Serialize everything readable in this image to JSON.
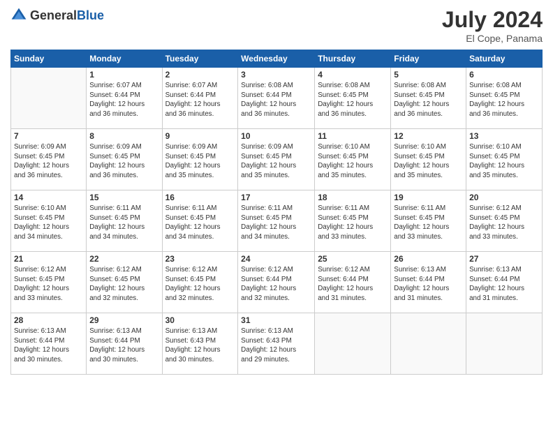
{
  "header": {
    "logo_general": "General",
    "logo_blue": "Blue",
    "main_title": "July 2024",
    "subtitle": "El Cope, Panama"
  },
  "weekdays": [
    "Sunday",
    "Monday",
    "Tuesday",
    "Wednesday",
    "Thursday",
    "Friday",
    "Saturday"
  ],
  "weeks": [
    [
      {
        "day": "",
        "info": ""
      },
      {
        "day": "1",
        "info": "Sunrise: 6:07 AM\nSunset: 6:44 PM\nDaylight: 12 hours\nand 36 minutes."
      },
      {
        "day": "2",
        "info": "Sunrise: 6:07 AM\nSunset: 6:44 PM\nDaylight: 12 hours\nand 36 minutes."
      },
      {
        "day": "3",
        "info": "Sunrise: 6:08 AM\nSunset: 6:44 PM\nDaylight: 12 hours\nand 36 minutes."
      },
      {
        "day": "4",
        "info": "Sunrise: 6:08 AM\nSunset: 6:45 PM\nDaylight: 12 hours\nand 36 minutes."
      },
      {
        "day": "5",
        "info": "Sunrise: 6:08 AM\nSunset: 6:45 PM\nDaylight: 12 hours\nand 36 minutes."
      },
      {
        "day": "6",
        "info": "Sunrise: 6:08 AM\nSunset: 6:45 PM\nDaylight: 12 hours\nand 36 minutes."
      }
    ],
    [
      {
        "day": "7",
        "info": "Sunrise: 6:09 AM\nSunset: 6:45 PM\nDaylight: 12 hours\nand 36 minutes."
      },
      {
        "day": "8",
        "info": "Sunrise: 6:09 AM\nSunset: 6:45 PM\nDaylight: 12 hours\nand 36 minutes."
      },
      {
        "day": "9",
        "info": "Sunrise: 6:09 AM\nSunset: 6:45 PM\nDaylight: 12 hours\nand 35 minutes."
      },
      {
        "day": "10",
        "info": "Sunrise: 6:09 AM\nSunset: 6:45 PM\nDaylight: 12 hours\nand 35 minutes."
      },
      {
        "day": "11",
        "info": "Sunrise: 6:10 AM\nSunset: 6:45 PM\nDaylight: 12 hours\nand 35 minutes."
      },
      {
        "day": "12",
        "info": "Sunrise: 6:10 AM\nSunset: 6:45 PM\nDaylight: 12 hours\nand 35 minutes."
      },
      {
        "day": "13",
        "info": "Sunrise: 6:10 AM\nSunset: 6:45 PM\nDaylight: 12 hours\nand 35 minutes."
      }
    ],
    [
      {
        "day": "14",
        "info": "Sunrise: 6:10 AM\nSunset: 6:45 PM\nDaylight: 12 hours\nand 34 minutes."
      },
      {
        "day": "15",
        "info": "Sunrise: 6:11 AM\nSunset: 6:45 PM\nDaylight: 12 hours\nand 34 minutes."
      },
      {
        "day": "16",
        "info": "Sunrise: 6:11 AM\nSunset: 6:45 PM\nDaylight: 12 hours\nand 34 minutes."
      },
      {
        "day": "17",
        "info": "Sunrise: 6:11 AM\nSunset: 6:45 PM\nDaylight: 12 hours\nand 34 minutes."
      },
      {
        "day": "18",
        "info": "Sunrise: 6:11 AM\nSunset: 6:45 PM\nDaylight: 12 hours\nand 33 minutes."
      },
      {
        "day": "19",
        "info": "Sunrise: 6:11 AM\nSunset: 6:45 PM\nDaylight: 12 hours\nand 33 minutes."
      },
      {
        "day": "20",
        "info": "Sunrise: 6:12 AM\nSunset: 6:45 PM\nDaylight: 12 hours\nand 33 minutes."
      }
    ],
    [
      {
        "day": "21",
        "info": "Sunrise: 6:12 AM\nSunset: 6:45 PM\nDaylight: 12 hours\nand 33 minutes."
      },
      {
        "day": "22",
        "info": "Sunrise: 6:12 AM\nSunset: 6:45 PM\nDaylight: 12 hours\nand 32 minutes."
      },
      {
        "day": "23",
        "info": "Sunrise: 6:12 AM\nSunset: 6:45 PM\nDaylight: 12 hours\nand 32 minutes."
      },
      {
        "day": "24",
        "info": "Sunrise: 6:12 AM\nSunset: 6:44 PM\nDaylight: 12 hours\nand 32 minutes."
      },
      {
        "day": "25",
        "info": "Sunrise: 6:12 AM\nSunset: 6:44 PM\nDaylight: 12 hours\nand 31 minutes."
      },
      {
        "day": "26",
        "info": "Sunrise: 6:13 AM\nSunset: 6:44 PM\nDaylight: 12 hours\nand 31 minutes."
      },
      {
        "day": "27",
        "info": "Sunrise: 6:13 AM\nSunset: 6:44 PM\nDaylight: 12 hours\nand 31 minutes."
      }
    ],
    [
      {
        "day": "28",
        "info": "Sunrise: 6:13 AM\nSunset: 6:44 PM\nDaylight: 12 hours\nand 30 minutes."
      },
      {
        "day": "29",
        "info": "Sunrise: 6:13 AM\nSunset: 6:44 PM\nDaylight: 12 hours\nand 30 minutes."
      },
      {
        "day": "30",
        "info": "Sunrise: 6:13 AM\nSunset: 6:43 PM\nDaylight: 12 hours\nand 30 minutes."
      },
      {
        "day": "31",
        "info": "Sunrise: 6:13 AM\nSunset: 6:43 PM\nDaylight: 12 hours\nand 29 minutes."
      },
      {
        "day": "",
        "info": ""
      },
      {
        "day": "",
        "info": ""
      },
      {
        "day": "",
        "info": ""
      }
    ]
  ]
}
